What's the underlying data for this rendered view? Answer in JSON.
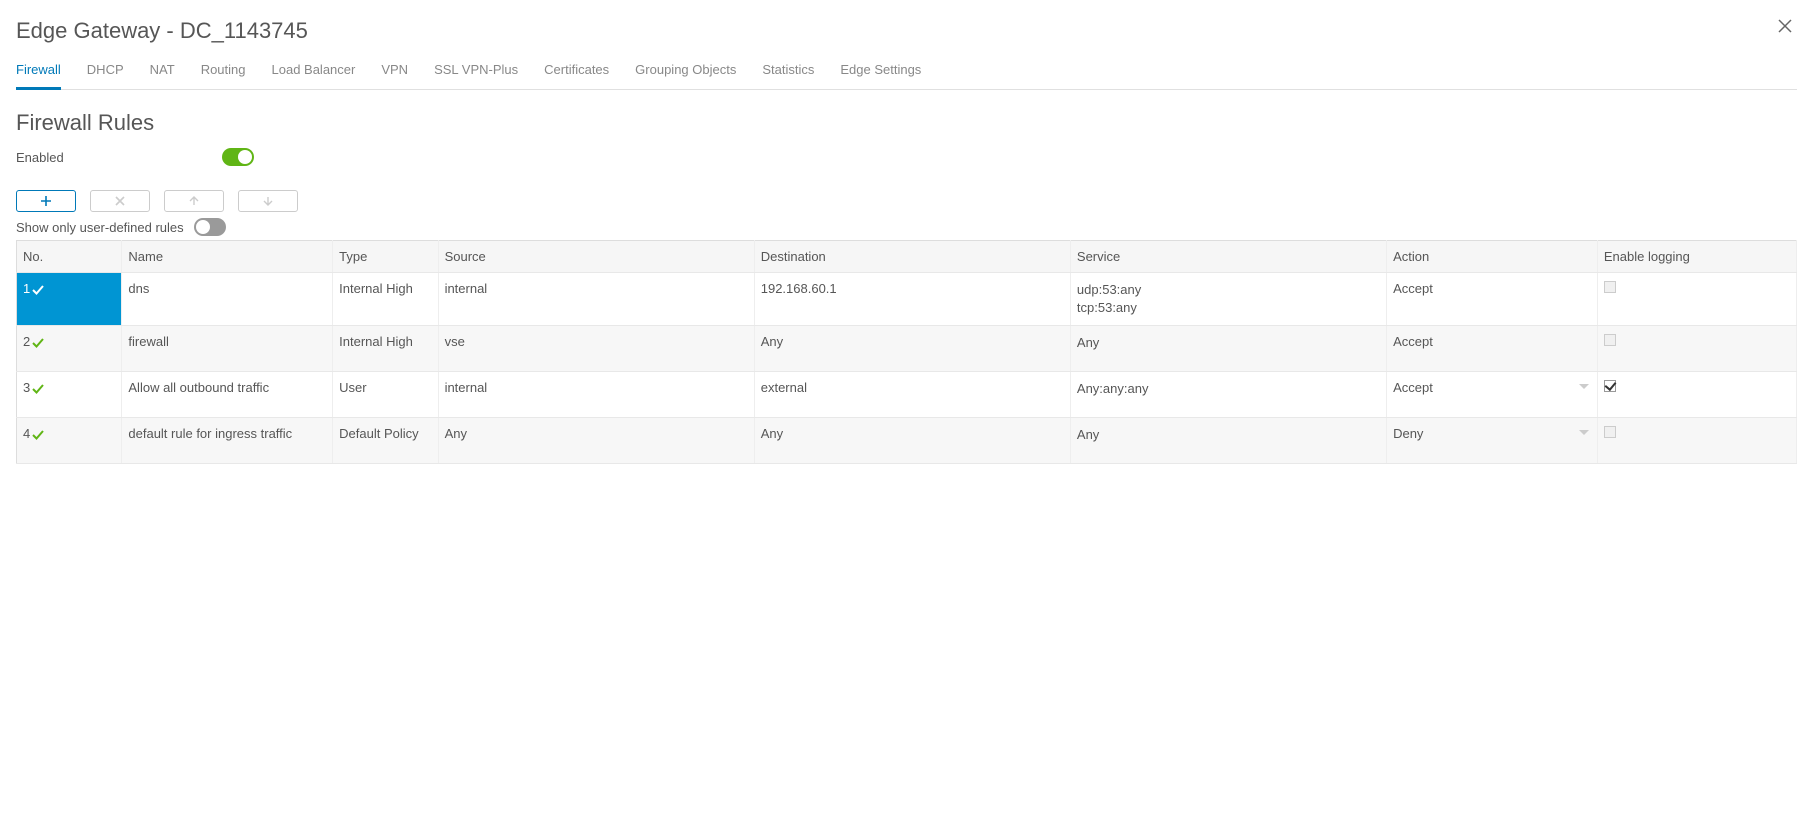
{
  "modal_title": "Edge Gateway - DC_1143745",
  "tabs": [
    {
      "label": "Firewall",
      "active": true
    },
    {
      "label": "DHCP",
      "active": false
    },
    {
      "label": "NAT",
      "active": false
    },
    {
      "label": "Routing",
      "active": false
    },
    {
      "label": "Load Balancer",
      "active": false
    },
    {
      "label": "VPN",
      "active": false
    },
    {
      "label": "SSL VPN-Plus",
      "active": false
    },
    {
      "label": "Certificates",
      "active": false
    },
    {
      "label": "Grouping Objects",
      "active": false
    },
    {
      "label": "Statistics",
      "active": false
    },
    {
      "label": "Edge Settings",
      "active": false
    }
  ],
  "section_title": "Firewall Rules",
  "enabled_label": "Enabled",
  "enabled_on": true,
  "user_rules_label": "Show only user-defined rules",
  "user_rules_on": false,
  "columns": {
    "no": "No.",
    "name": "Name",
    "type": "Type",
    "source": "Source",
    "destination": "Destination",
    "service": "Service",
    "action": "Action",
    "log": "Enable logging"
  },
  "rows": [
    {
      "no": "1",
      "selected": true,
      "name": "dns",
      "type": "Internal High",
      "source": "internal",
      "dest": "192.168.60.1",
      "service": [
        "udp:53:any",
        "tcp:53:any"
      ],
      "action": "Accept",
      "action_dropdown": false,
      "log_checked": false,
      "log_disabled": true
    },
    {
      "no": "2",
      "selected": false,
      "name": "firewall",
      "type": "Internal High",
      "source": "vse",
      "dest": "Any",
      "service": [
        "Any"
      ],
      "action": "Accept",
      "action_dropdown": false,
      "log_checked": false,
      "log_disabled": true
    },
    {
      "no": "3",
      "selected": false,
      "name": "Allow all outbound traffic",
      "type": "User",
      "source": "internal",
      "dest": "external",
      "service": [
        "Any:any:any"
      ],
      "action": "Accept",
      "action_dropdown": true,
      "log_checked": true,
      "log_disabled": false
    },
    {
      "no": "4",
      "selected": false,
      "name": "default rule for ingress traffic",
      "type": "Default Policy",
      "source": "Any",
      "dest": "Any",
      "service": [
        "Any"
      ],
      "action": "Deny",
      "action_dropdown": true,
      "log_checked": false,
      "log_disabled": true
    }
  ]
}
